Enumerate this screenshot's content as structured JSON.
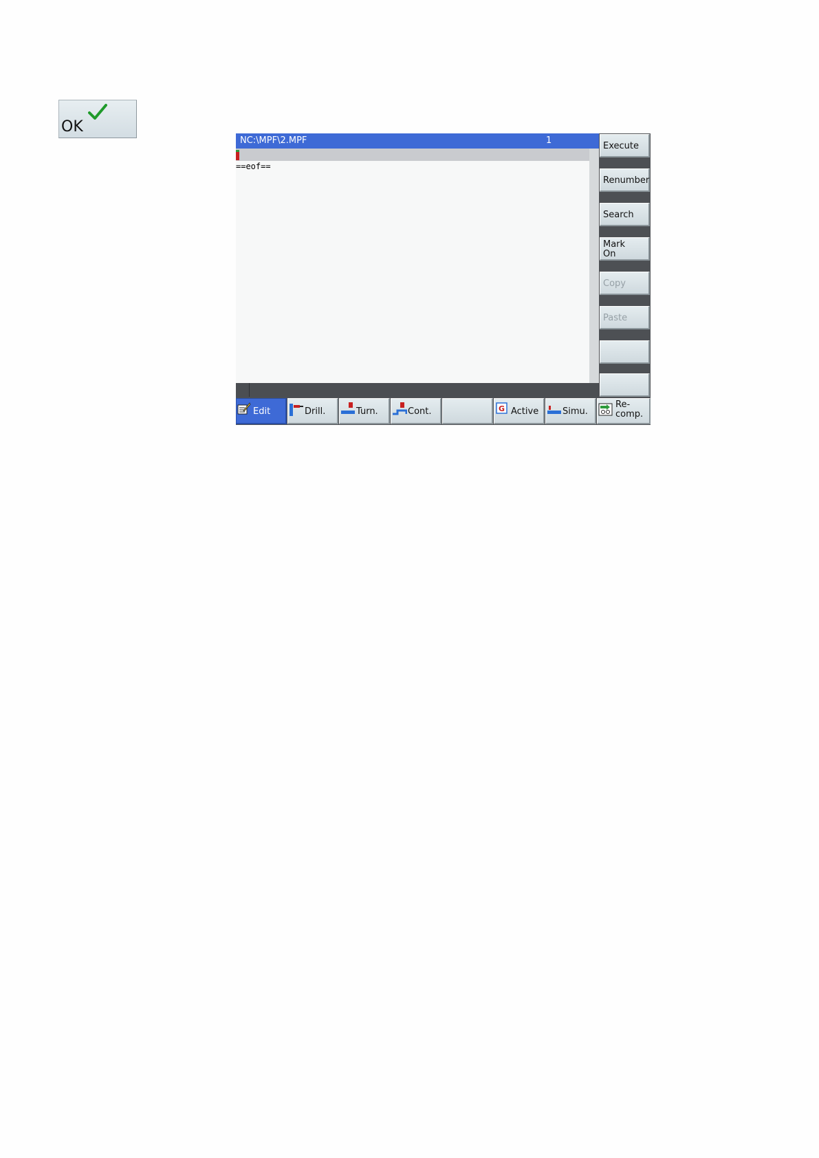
{
  "ok_button": {
    "label": "OK"
  },
  "editor": {
    "file_path": "NC:\\MPF\\2.MPF",
    "line_number": "1",
    "eof_marker": "==eof=="
  },
  "vertical_softkeys": [
    {
      "label": "Execute",
      "enabled": true
    },
    {
      "label": "Renumber",
      "enabled": true
    },
    {
      "label": "Search",
      "enabled": true
    },
    {
      "label": "Mark",
      "label2": "On",
      "enabled": true
    },
    {
      "label": "Copy",
      "enabled": false
    },
    {
      "label": "Paste",
      "enabled": false
    },
    {
      "label": "",
      "enabled": true
    },
    {
      "label": "",
      "enabled": true
    }
  ],
  "horizontal_softkeys": [
    {
      "label": "Edit",
      "icon": "edit-icon",
      "active": true
    },
    {
      "label": "Drill.",
      "icon": "drill-icon"
    },
    {
      "label": "Turn.",
      "icon": "turn-icon"
    },
    {
      "label": "Cont.",
      "icon": "contour-icon"
    },
    {
      "label": ""
    },
    {
      "label": "Active",
      "icon": "g-code-icon"
    },
    {
      "label": "Simu.",
      "icon": "simulation-icon"
    },
    {
      "label": "Re-",
      "label2": "comp.",
      "icon": "recompile-icon"
    }
  ],
  "colors": {
    "title_bar": "#3e6ad6",
    "softkey": "#d8e1e6",
    "frame": "#4d5054",
    "check": "#1f9a2a"
  }
}
